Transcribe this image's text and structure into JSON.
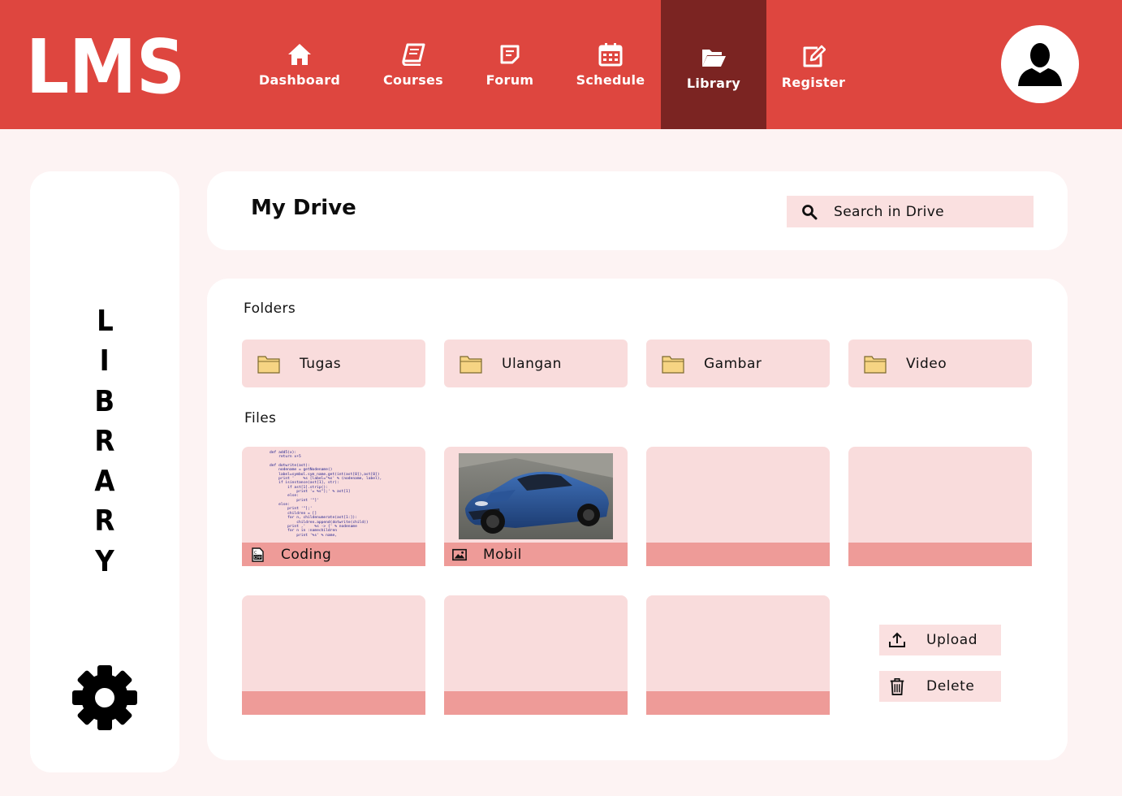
{
  "app": {
    "logo_text": "LMS",
    "accent_color": "#de463f",
    "active_nav_color": "#7b2422"
  },
  "nav": {
    "items": [
      {
        "label": "Dashboard",
        "icon": "home-icon"
      },
      {
        "label": "Courses",
        "icon": "book-icon"
      },
      {
        "label": "Forum",
        "icon": "note-icon"
      },
      {
        "label": "Schedule",
        "icon": "calendar-icon"
      },
      {
        "label": "Library",
        "icon": "folder-open-icon",
        "active": true
      },
      {
        "label": "Register",
        "icon": "edit-icon"
      }
    ]
  },
  "user": {
    "avatar_icon": "user-icon"
  },
  "sidebar": {
    "title_letters": [
      "L",
      "I",
      "B",
      "R",
      "A",
      "R",
      "Y"
    ],
    "settings_icon": "gear-icon"
  },
  "drive": {
    "title": "My Drive",
    "search_placeholder": "Search in Drive"
  },
  "folders": {
    "label": "Folders",
    "items": [
      "Tugas",
      "Ulangan",
      "Gambar",
      "Video"
    ]
  },
  "files": {
    "label": "Files",
    "items": [
      {
        "name": "Coding",
        "icon": "cpp-file-icon",
        "thumb": "code-preview"
      },
      {
        "name": "Mobil",
        "icon": "image-icon",
        "thumb": "car-photo"
      },
      {
        "name": "",
        "thumb": "empty"
      },
      {
        "name": "",
        "thumb": "empty"
      },
      {
        "name": "",
        "thumb": "empty"
      },
      {
        "name": "",
        "thumb": "empty"
      },
      {
        "name": "",
        "thumb": "empty"
      }
    ]
  },
  "actions": {
    "upload": "Upload",
    "delete": "Delete"
  },
  "code_preview": "def add5(x):\n    return x+5\n\ndef dotwrite(ast):\n    nodename = getNodename()\n    label=symbol.sym_name.get(int(ast[0]),ast[0])\n    print '    %s [label=\"%s' % (nodename, label),\n    if isinstance(ast[1], str):\n        if ast[1].strip():\n            print '= %s\"];' % ast[1]\n        else:\n            print '\"]'\n    else:\n        print '\"];'\n        children = []\n        for n, childenumerate(ast[1:]):\n            children.append(dotwrite(child))\n        print ,'    %s -> {' % nodename\n        for n in :namechildren\n            print '%s' % name,"
}
